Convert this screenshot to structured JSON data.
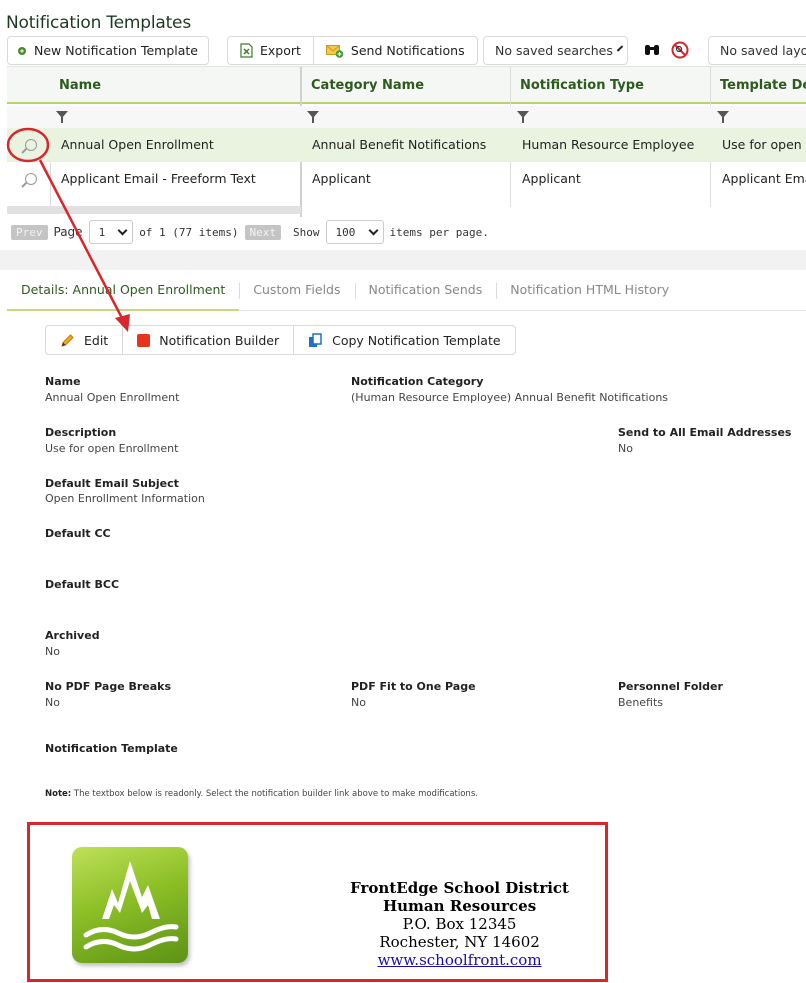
{
  "page": {
    "title": "Notification Templates"
  },
  "toolbar": {
    "new_label": "New Notification Template",
    "export_label": "Export",
    "send_label": "Send Notifications",
    "saved_searches": "No saved searches",
    "saved_layouts": "No saved layou"
  },
  "grid": {
    "columns": [
      "Name",
      "Category Name",
      "Notification Type",
      "Template Des"
    ],
    "rows": [
      {
        "name": "Annual Open Enrollment",
        "category": "Annual Benefit Notifications",
        "type": "Human Resource Employee",
        "desc": "Use for open En"
      },
      {
        "name": "Applicant Email - Freeform Text",
        "category": "Applicant",
        "type": "Applicant",
        "desc": "Applicant Emai"
      }
    ],
    "pager": {
      "prev": "Prev",
      "page_label": "Page",
      "page_value": "1",
      "of_label": "of 1 (77 items)",
      "next": "Next",
      "show_label": "Show",
      "page_size": "100",
      "per_page_label": "items per page."
    }
  },
  "tabs": [
    "Details: Annual Open Enrollment",
    "Custom Fields",
    "Notification Sends",
    "Notification HTML History"
  ],
  "actions": {
    "edit": "Edit",
    "builder": "Notification Builder",
    "copy": "Copy Notification Template"
  },
  "details": {
    "name_label": "Name",
    "name_value": "Annual Open Enrollment",
    "category_label": "Notification Category",
    "category_value": "(Human Resource Employee) Annual Benefit Notifications",
    "description_label": "Description",
    "description_value": "Use for open Enrollment",
    "send_all_label": "Send to All Email Addresses",
    "send_all_value": "No",
    "subject_label": "Default Email Subject",
    "subject_value": "Open Enrollment Information",
    "cc_label": "Default CC",
    "bcc_label": "Default BCC",
    "archived_label": "Archived",
    "archived_value": "No",
    "pdf_breaks_label": "No PDF Page Breaks",
    "pdf_breaks_value": "No",
    "pdf_fit_label": "PDF Fit to One Page",
    "pdf_fit_value": "No",
    "folder_label": "Personnel Folder",
    "folder_value": "Benefits",
    "template_label": "Notification Template",
    "note_bold": "Note:",
    "note_text": " The textbox below is readonly. Select the notification builder link above to make modifications."
  },
  "letterhead": {
    "district": "FrontEdge School District",
    "department": "Human Resources",
    "address1": "P.O. Box 12345",
    "address2": "Rochester, NY 14602",
    "website": "www.schoolfront.com"
  },
  "colors": {
    "accent_green": "#b7d36a",
    "header_text": "#2d5a1e",
    "annotation_red": "#d9262c",
    "selected_row": "#e9f3e0"
  }
}
